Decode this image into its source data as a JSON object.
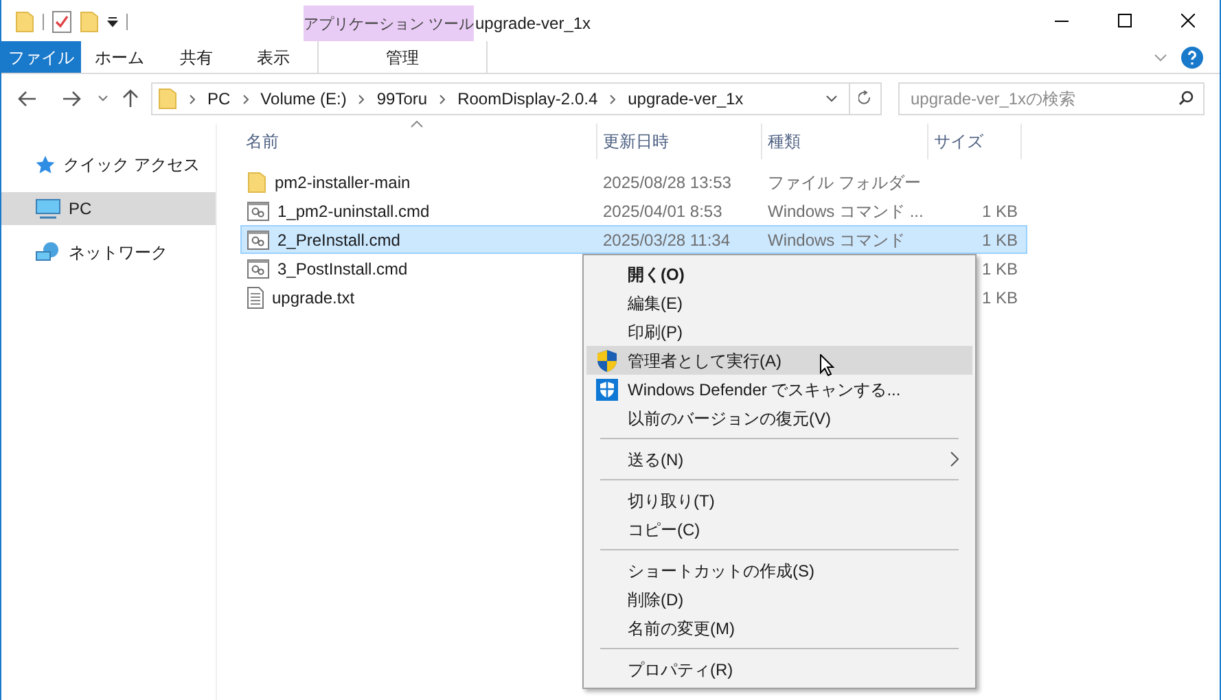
{
  "window": {
    "title": "upgrade-ver_1x"
  },
  "ribbon": {
    "context_group": "アプリケーション ツール",
    "tabs": [
      {
        "label": "ファイル",
        "selected": true,
        "kind": "file"
      },
      {
        "label": "ホーム",
        "selected": false,
        "kind": "tab"
      },
      {
        "label": "共有",
        "selected": false,
        "kind": "tab"
      },
      {
        "label": "表示",
        "selected": false,
        "kind": "tab"
      },
      {
        "label": "管理",
        "selected": false,
        "kind": "context"
      }
    ]
  },
  "address": {
    "path": [
      "PC",
      "Volume (E:)",
      "99Toru",
      "RoomDisplay-2.0.4",
      "upgrade-ver_1x"
    ],
    "search_placeholder": "upgrade-ver_1xの検索"
  },
  "sidebar": {
    "items": [
      {
        "label": "クイック アクセス",
        "kind": "star",
        "selected": false
      },
      {
        "label": "PC",
        "kind": "pc",
        "selected": true
      },
      {
        "label": "ネットワーク",
        "kind": "network",
        "selected": false
      }
    ]
  },
  "table": {
    "columns": [
      "名前",
      "更新日時",
      "種類",
      "サイズ"
    ],
    "rows": [
      {
        "name": "pm2-installer-main",
        "kind": "folder",
        "date": "2025/08/28 13:53",
        "type": "ファイル フォルダー",
        "selected": false
      },
      {
        "name": "1_pm2-uninstall.cmd",
        "kind": "cmd",
        "date": "2025/04/01 8:53",
        "type": "Windows コマンド ...",
        "size": "1 KB",
        "selected": false
      },
      {
        "name": "2_PreInstall.cmd",
        "kind": "cmd",
        "date": "2025/03/28 11:34",
        "type": "Windows コマンド",
        "size": "1 KB",
        "selected": true
      },
      {
        "name": "3_PostInstall.cmd",
        "kind": "cmd",
        "size": "1 KB",
        "selected": false
      },
      {
        "name": "upgrade.txt",
        "kind": "txt",
        "size": "1 KB",
        "selected": false
      }
    ]
  },
  "context_menu": {
    "items": [
      {
        "kind": "item",
        "label": "開く(O)",
        "bold": true,
        "selected": false
      },
      {
        "kind": "item",
        "label": "編集(E)",
        "bold": false,
        "selected": false
      },
      {
        "kind": "item",
        "label": "印刷(P)",
        "bold": false,
        "selected": false
      },
      {
        "kind": "shield-item",
        "label": "管理者として実行(A)",
        "bold": false,
        "selected": true
      },
      {
        "kind": "scan-item",
        "label": "Windows Defender でスキャンする...",
        "bold": false,
        "selected": false
      },
      {
        "kind": "item",
        "label": "以前のバージョンの復元(V)",
        "bold": false,
        "selected": false
      },
      {
        "kind": "separator"
      },
      {
        "kind": "item",
        "label": "送る(N)",
        "bold": false,
        "selected": false,
        "submenu": true
      },
      {
        "kind": "separator"
      },
      {
        "kind": "item",
        "label": "切り取り(T)",
        "bold": false,
        "selected": false
      },
      {
        "kind": "item",
        "label": "コピー(C)",
        "bold": false,
        "selected": false
      },
      {
        "kind": "separator"
      },
      {
        "kind": "item",
        "label": "ショートカットの作成(S)",
        "bold": false,
        "selected": false
      },
      {
        "kind": "item",
        "label": "削除(D)",
        "bold": false,
        "selected": false
      },
      {
        "kind": "item",
        "label": "名前の変更(M)",
        "bold": false,
        "selected": false
      },
      {
        "kind": "separator"
      },
      {
        "kind": "item",
        "label": "プロパティ(R)",
        "bold": false,
        "selected": false
      }
    ]
  }
}
